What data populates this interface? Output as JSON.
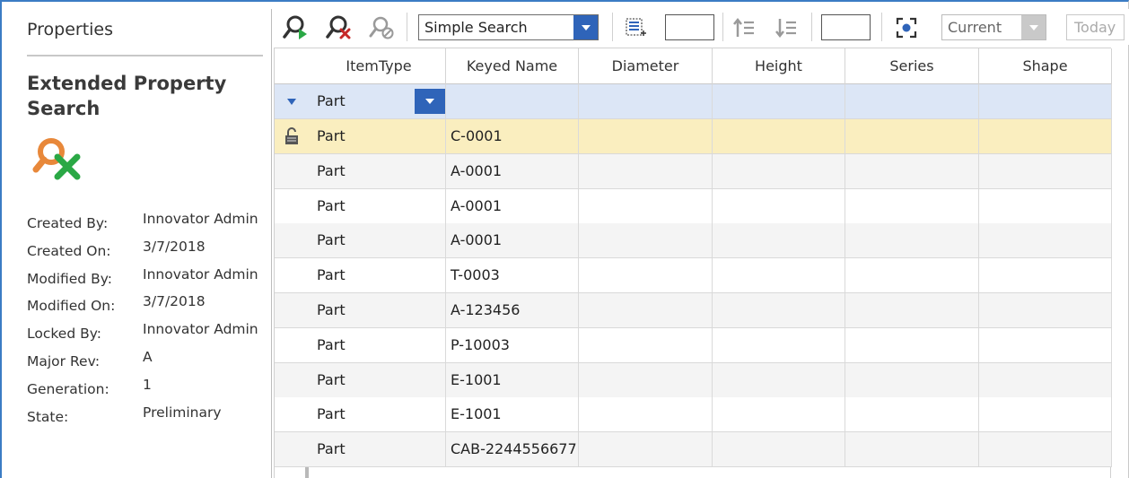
{
  "properties": {
    "title": "Properties",
    "heading": "Extended Property Search",
    "icon": "search-cross-icon",
    "fields": [
      {
        "label": "Created By:",
        "value": "Innovator Admin"
      },
      {
        "label": "Created On:",
        "value": "3/7/2018"
      },
      {
        "label": "Modified By:",
        "value": "Innovator Admin"
      },
      {
        "label": "Modified On:",
        "value": "3/7/2018"
      },
      {
        "label": "Locked By:",
        "value": "Innovator Admin"
      },
      {
        "label": "Major Rev:",
        "value": "A"
      },
      {
        "label": "Generation:",
        "value": "1"
      },
      {
        "label": "State:",
        "value": "Preliminary"
      }
    ]
  },
  "toolbar": {
    "run_search_icon": "run-search-icon",
    "clear_search_icon": "clear-search-icon",
    "stop_search_icon": "stop-search-icon",
    "search_mode": "Simple Search",
    "page_size_icon": "page-size-icon",
    "sort_asc_icon": "sort-ascending-icon",
    "sort_desc_icon": "sort-descending-icon",
    "focus_icon": "focus-icon",
    "version": "Current",
    "date_label": "Today"
  },
  "grid": {
    "columns": [
      "ItemType",
      "Keyed Name",
      "Diameter",
      "Height",
      "Series",
      "Shape"
    ],
    "search_row": {
      "itemtype": "Part"
    },
    "rows": [
      {
        "itemtype": "Part",
        "keyed_name": "C-0001",
        "locked": true
      },
      {
        "itemtype": "Part",
        "keyed_name": "A-0001"
      },
      {
        "itemtype": "Part",
        "keyed_name": "A-0001"
      },
      {
        "itemtype": "Part",
        "keyed_name": "A-0001"
      },
      {
        "itemtype": "Part",
        "keyed_name": "T-0003"
      },
      {
        "itemtype": "Part",
        "keyed_name": "A-123456"
      },
      {
        "itemtype": "Part",
        "keyed_name": "P-10003"
      },
      {
        "itemtype": "Part",
        "keyed_name": "E-1001"
      },
      {
        "itemtype": "Part",
        "keyed_name": "E-1001"
      },
      {
        "itemtype": "Part",
        "keyed_name": "CAB-2244556677"
      }
    ]
  },
  "colors": {
    "accent": "#2f64b9",
    "selected_row": "#faeebf",
    "search_row": "#dce6f6",
    "icon_orange": "#e8883a",
    "icon_green": "#2aa845",
    "icon_red": "#c62828"
  }
}
